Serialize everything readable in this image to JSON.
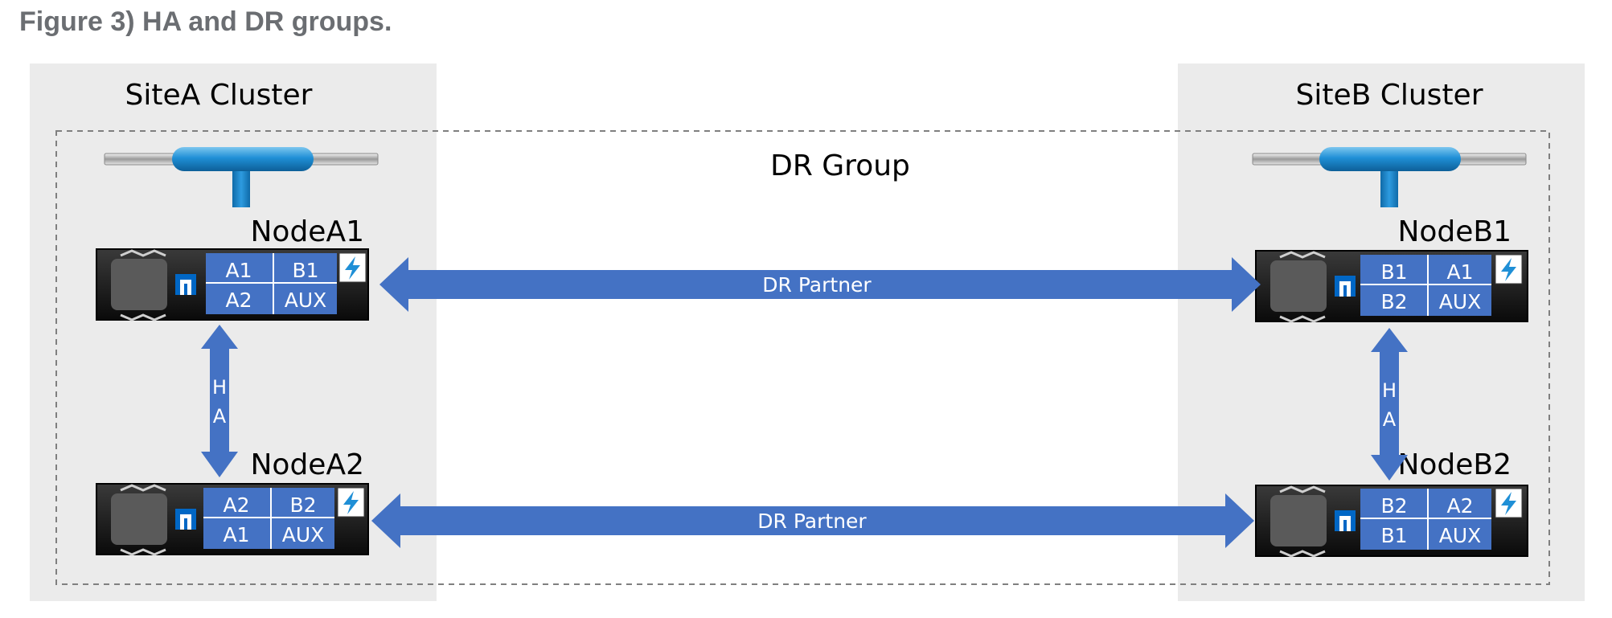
{
  "figure_title": "Figure 3) HA and DR groups.",
  "site_a": {
    "label": "SiteA Cluster"
  },
  "site_b": {
    "label": "SiteB Cluster"
  },
  "dr_group": {
    "label": "DR Group"
  },
  "nodes": {
    "a1": {
      "name": "NodeA1",
      "ports": [
        "A1",
        "B1",
        "A2",
        "AUX"
      ]
    },
    "a2": {
      "name": "NodeA2",
      "ports": [
        "A2",
        "B2",
        "A1",
        "AUX"
      ]
    },
    "b1": {
      "name": "NodeB1",
      "ports": [
        "B1",
        "A1",
        "B2",
        "AUX"
      ]
    },
    "b2": {
      "name": "NodeB2",
      "ports": [
        "B2",
        "A2",
        "B1",
        "AUX"
      ]
    }
  },
  "links": {
    "dr_top": "DR Partner",
    "dr_bottom": "DR  Partner",
    "ha_left": [
      "H",
      "A"
    ],
    "ha_right": [
      "H",
      "A"
    ]
  },
  "colors": {
    "site_bg": "#ebebeb",
    "arrow": "#4472c4",
    "port_panel": "#4472c4",
    "switch_blue": "#1f8fd6",
    "dashed_border": "#7f7f7f",
    "title_gray": "#6b6e72"
  },
  "icons": [
    "switch-icon",
    "netapp-logo-icon",
    "lightning-icon"
  ]
}
